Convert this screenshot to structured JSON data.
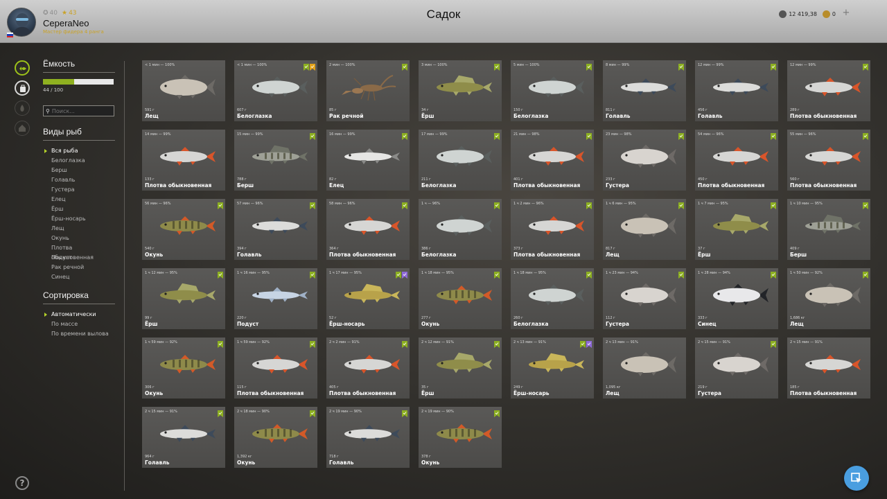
{
  "header": {
    "title": "Садок",
    "username": "CeperaNeo",
    "rank": "Мастер фидера 4 ранга",
    "level1": "40",
    "level2": "43",
    "silver": "12 419,38",
    "gold": "0"
  },
  "sidebar": {
    "capacity_title": "Ёмкость",
    "capacity_text": "44 / 100",
    "capacity_fraction": 0.44,
    "search_placeholder": "Поиск...",
    "species_title": "Виды рыб",
    "species": [
      "Вся рыба",
      "Белоглазка",
      "Берш",
      "Голавль",
      "Густера",
      "Елец",
      "Ёрш",
      "Ёрш-носарь",
      "Лещ",
      "Окунь",
      "Плотва обыкновенная",
      "Подуст",
      "Рак речной",
      "Синец"
    ],
    "sort_title": "Сортировка",
    "sort": [
      "Автоматически",
      "По массе",
      "По времени вылова"
    ]
  },
  "colors": {
    "accent": "#9ec31a",
    "badge_green": "#8db021",
    "badge_orange": "#e2a21a",
    "badge_purple": "#8f6ad8",
    "fab_blue": "#4a9ee0"
  },
  "cards": [
    {
      "time": "< 1 мин — 100%",
      "weight": "591 г",
      "name": "Лещ",
      "fish": "bream",
      "badges": []
    },
    {
      "time": "< 1 мин — 100%",
      "weight": "607 г",
      "name": "Белоглазка",
      "fish": "whitebream",
      "badges": [
        "green",
        "orange"
      ]
    },
    {
      "time": "2 мин — 100%",
      "weight": "85 г",
      "name": "Рак речной",
      "fish": "crayfish",
      "badges": [
        "green"
      ]
    },
    {
      "time": "3 мин — 100%",
      "weight": "34 г",
      "name": "Ёрш",
      "fish": "ruffe",
      "badges": [
        "green"
      ]
    },
    {
      "time": "5 мин — 100%",
      "weight": "150 г",
      "name": "Белоглазка",
      "fish": "whitebream",
      "badges": [
        "green"
      ]
    },
    {
      "time": "8 мин — 99%",
      "weight": "811 г",
      "name": "Голавль",
      "fish": "chub",
      "badges": [
        "green"
      ]
    },
    {
      "time": "12 мин — 99%",
      "weight": "456 г",
      "name": "Голавль",
      "fish": "chub",
      "badges": [
        "green"
      ]
    },
    {
      "time": "12 мин — 99%",
      "weight": "289 г",
      "name": "Плотва обыкновенная",
      "fish": "roach",
      "badges": [
        "green"
      ]
    },
    {
      "time": "14 мин — 99%",
      "weight": "133 г",
      "name": "Плотва обыкновенная",
      "fish": "roach",
      "badges": []
    },
    {
      "time": "15 мин — 99%",
      "weight": "788 г",
      "name": "Берш",
      "fish": "bersh",
      "badges": [
        "green"
      ]
    },
    {
      "time": "16 мин — 99%",
      "weight": "82 г",
      "name": "Елец",
      "fish": "dace",
      "badges": [
        "green"
      ]
    },
    {
      "time": "17 мин — 99%",
      "weight": "211 г",
      "name": "Белоглазка",
      "fish": "whitebream",
      "badges": [
        "green"
      ]
    },
    {
      "time": "21 мин — 98%",
      "weight": "401 г",
      "name": "Плотва обыкновенная",
      "fish": "roach",
      "badges": [
        "green"
      ]
    },
    {
      "time": "23 мин — 98%",
      "weight": "233 г",
      "name": "Густера",
      "fish": "silverbream",
      "badges": [
        "green"
      ]
    },
    {
      "time": "54 мин — 96%",
      "weight": "450 г",
      "name": "Плотва обыкновенная",
      "fish": "roach",
      "badges": [
        "green"
      ]
    },
    {
      "time": "55 мин — 96%",
      "weight": "560 г",
      "name": "Плотва обыкновенная",
      "fish": "roach",
      "badges": [
        "green"
      ]
    },
    {
      "time": "56 мин — 96%",
      "weight": "540 г",
      "name": "Окунь",
      "fish": "perch",
      "badges": [
        "green"
      ]
    },
    {
      "time": "57 мин — 96%",
      "weight": "394 г",
      "name": "Голавль",
      "fish": "chub",
      "badges": [
        "green"
      ]
    },
    {
      "time": "58 мин — 96%",
      "weight": "364 г",
      "name": "Плотва обыкновенная",
      "fish": "roach",
      "badges": [
        "green"
      ]
    },
    {
      "time": "1 ч — 96%",
      "weight": "386 г",
      "name": "Белоглазка",
      "fish": "whitebream",
      "badges": [
        "green"
      ]
    },
    {
      "time": "1 ч 2 мин — 96%",
      "weight": "373 г",
      "name": "Плотва обыкновенная",
      "fish": "roach",
      "badges": [
        "green"
      ]
    },
    {
      "time": "1 ч 6 мин — 95%",
      "weight": "817 г",
      "name": "Лещ",
      "fish": "bream",
      "badges": [
        "green"
      ]
    },
    {
      "time": "1 ч 7 мин — 95%",
      "weight": "37 г",
      "name": "Ёрш",
      "fish": "ruffe",
      "badges": [
        "green"
      ]
    },
    {
      "time": "1 ч 10 мин — 95%",
      "weight": "409 г",
      "name": "Берш",
      "fish": "bersh",
      "badges": [
        "green"
      ]
    },
    {
      "time": "1 ч 12 мин — 95%",
      "weight": "99 г",
      "name": "Ёрш",
      "fish": "ruffe",
      "badges": [
        "green"
      ]
    },
    {
      "time": "1 ч 16 мин — 95%",
      "weight": "220 г",
      "name": "Подуст",
      "fish": "nase",
      "badges": [
        "green"
      ]
    },
    {
      "time": "1 ч 17 мин — 95%",
      "weight": "52 г",
      "name": "Ёрш-носарь",
      "fish": "schraetzer",
      "badges": [
        "green",
        "purple"
      ]
    },
    {
      "time": "1 ч 18 мин — 95%",
      "weight": "277 г",
      "name": "Окунь",
      "fish": "perch",
      "badges": [
        "green"
      ]
    },
    {
      "time": "1 ч 18 мин — 95%",
      "weight": "260 г",
      "name": "Белоглазка",
      "fish": "whitebream",
      "badges": [
        "green"
      ]
    },
    {
      "time": "1 ч 23 мин — 94%",
      "weight": "112 г",
      "name": "Густера",
      "fish": "silverbream",
      "badges": [
        "green"
      ]
    },
    {
      "time": "1 ч 28 мин — 94%",
      "weight": "333 г",
      "name": "Синец",
      "fish": "bluebream",
      "badges": [
        "green"
      ]
    },
    {
      "time": "1 ч 50 мин — 92%",
      "weight": "1,686 кг",
      "name": "Лещ",
      "fish": "bream",
      "badges": [
        "green"
      ]
    },
    {
      "time": "1 ч 59 мин — 92%",
      "weight": "306 г",
      "name": "Окунь",
      "fish": "perch",
      "badges": [
        "green"
      ]
    },
    {
      "time": "1 ч 59 мин — 92%",
      "weight": "115 г",
      "name": "Плотва обыкновенная",
      "fish": "roach",
      "badges": [
        "green"
      ]
    },
    {
      "time": "2 ч 2 мин — 91%",
      "weight": "405 г",
      "name": "Плотва обыкновенная",
      "fish": "roach",
      "badges": [
        "green"
      ]
    },
    {
      "time": "2 ч 12 мин — 91%",
      "weight": "35 г",
      "name": "Ёрш",
      "fish": "ruffe",
      "badges": [
        "green"
      ]
    },
    {
      "time": "2 ч 13 мин — 91%",
      "weight": "249 г",
      "name": "Ёрш-носарь",
      "fish": "schraetzer",
      "badges": [
        "green",
        "purple"
      ]
    },
    {
      "time": "2 ч 13 мин — 91%",
      "weight": "1,095 кг",
      "name": "Лещ",
      "fish": "bream",
      "badges": []
    },
    {
      "time": "2 ч 15 мин — 91%",
      "weight": "219 г",
      "name": "Густера",
      "fish": "silverbream",
      "badges": [
        "green"
      ]
    },
    {
      "time": "2 ч 15 мин — 91%",
      "weight": "185 г",
      "name": "Плотва обыкновенная",
      "fish": "roach",
      "badges": []
    },
    {
      "time": "2 ч 15 мин — 91%",
      "weight": "964 г",
      "name": "Голавль",
      "fish": "chub",
      "badges": [
        "green"
      ]
    },
    {
      "time": "2 ч 18 мин — 90%",
      "weight": "1,392 кг",
      "name": "Окунь",
      "fish": "perch",
      "badges": [
        "green"
      ]
    },
    {
      "time": "2 ч 19 мин — 90%",
      "weight": "718 г",
      "name": "Голавль",
      "fish": "chub",
      "badges": [
        "green"
      ]
    },
    {
      "time": "2 ч 19 мин — 90%",
      "weight": "378 г",
      "name": "Окунь",
      "fish": "perch",
      "badges": [
        "green"
      ]
    }
  ]
}
